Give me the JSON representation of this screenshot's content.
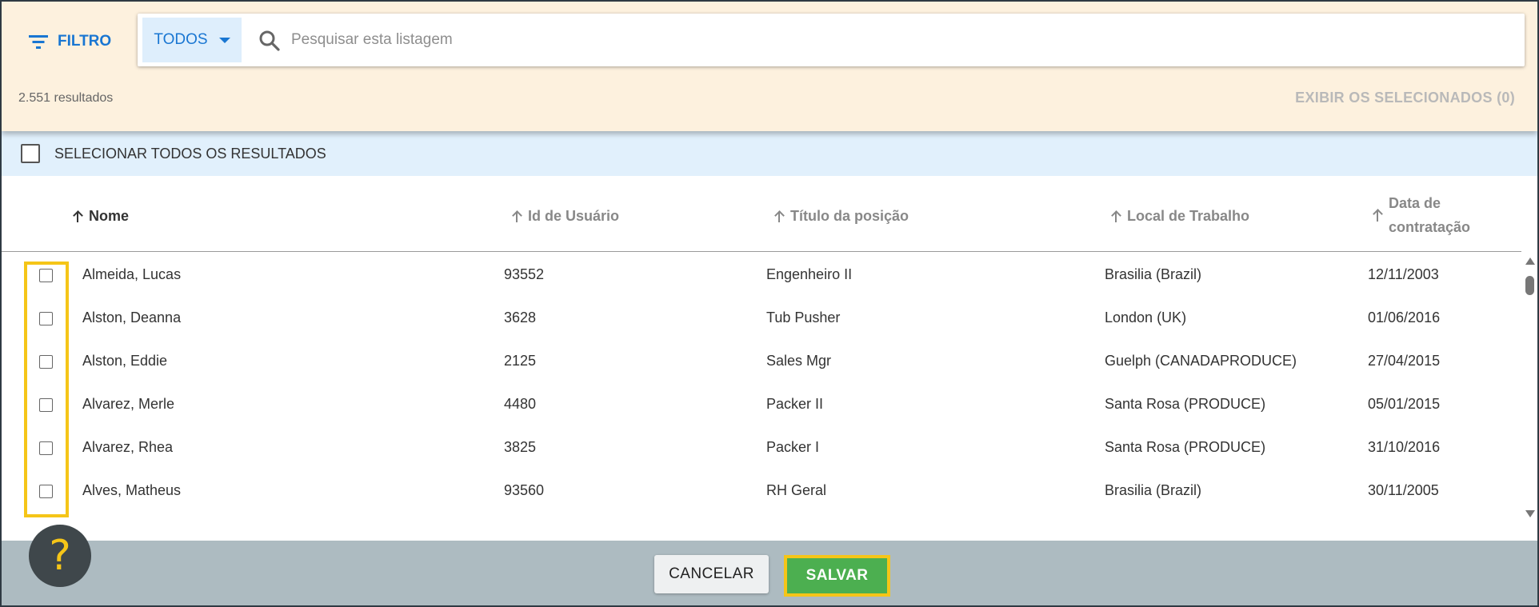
{
  "header": {
    "filter_label": "FILTRO",
    "scope_selected": "TODOS",
    "search_placeholder": "Pesquisar esta listagem",
    "search_value": "",
    "results_count": "2.551 resultados",
    "show_selected_label": "EXIBIR OS SELECIONADOS (0)"
  },
  "select_all_label": "SELECIONAR TODOS OS RESULTADOS",
  "columns": {
    "name": "Nome",
    "user_id": "Id de Usuário",
    "position": "Título da posição",
    "location": "Local de Trabalho",
    "hire_date_line1": "Data de",
    "hire_date_line2": "contratação"
  },
  "rows": [
    {
      "name": "Almeida, Lucas",
      "user_id": "93552",
      "position": "Engenheiro II",
      "location": "Brasilia (Brazil)",
      "hire_date": "12/11/2003"
    },
    {
      "name": "Alston, Deanna",
      "user_id": "3628",
      "position": "Tub Pusher",
      "location": "London (UK)",
      "hire_date": "01/06/2016"
    },
    {
      "name": "Alston, Eddie",
      "user_id": "2125",
      "position": "Sales Mgr",
      "location": "Guelph (CANADAPRODUCE)",
      "hire_date": "27/04/2015"
    },
    {
      "name": "Alvarez, Merle",
      "user_id": "4480",
      "position": "Packer II",
      "location": "Santa Rosa (PRODUCE)",
      "hire_date": "05/01/2015"
    },
    {
      "name": "Alvarez, Rhea",
      "user_id": "3825",
      "position": "Packer I",
      "location": "Santa Rosa (PRODUCE)",
      "hire_date": "31/10/2016"
    },
    {
      "name": "Alves, Matheus",
      "user_id": "93560",
      "position": "RH Geral",
      "location": "Brasilia (Brazil)",
      "hire_date": "30/11/2005"
    }
  ],
  "footer": {
    "cancel_label": "CANCELAR",
    "save_label": "SALVAR"
  },
  "help_glyph": "?",
  "colors": {
    "accent": "#1976d2",
    "header_bg": "#fdf1de",
    "select_bar_bg": "#e1f0fc",
    "footer_bg": "#adbbc1",
    "save_green": "#4caf50",
    "highlight": "#f5c518"
  }
}
